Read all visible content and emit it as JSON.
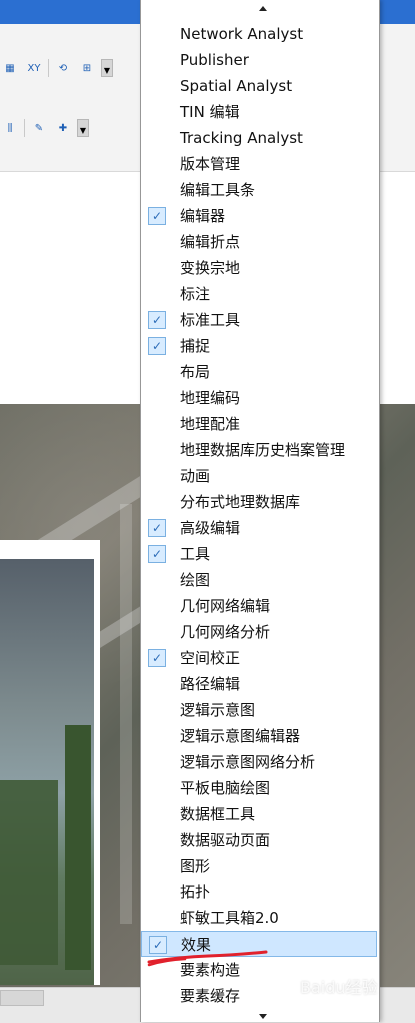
{
  "menu": {
    "items": [
      {
        "label": "Network Analyst",
        "checked": false
      },
      {
        "label": "Publisher",
        "checked": false
      },
      {
        "label": "Spatial Analyst",
        "checked": false
      },
      {
        "label": "TIN 编辑",
        "checked": false
      },
      {
        "label": "Tracking Analyst",
        "checked": false
      },
      {
        "label": "版本管理",
        "checked": false
      },
      {
        "label": "编辑工具条",
        "checked": false
      },
      {
        "label": "编辑器",
        "checked": true
      },
      {
        "label": "编辑折点",
        "checked": false
      },
      {
        "label": "变换宗地",
        "checked": false
      },
      {
        "label": "标注",
        "checked": false
      },
      {
        "label": "标准工具",
        "checked": true
      },
      {
        "label": "捕捉",
        "checked": true
      },
      {
        "label": "布局",
        "checked": false
      },
      {
        "label": "地理编码",
        "checked": false
      },
      {
        "label": "地理配准",
        "checked": false
      },
      {
        "label": "地理数据库历史档案管理",
        "checked": false
      },
      {
        "label": "动画",
        "checked": false
      },
      {
        "label": "分布式地理数据库",
        "checked": false
      },
      {
        "label": "高级编辑",
        "checked": true
      },
      {
        "label": "工具",
        "checked": true
      },
      {
        "label": "绘图",
        "checked": false
      },
      {
        "label": "几何网络编辑",
        "checked": false
      },
      {
        "label": "几何网络分析",
        "checked": false
      },
      {
        "label": "空间校正",
        "checked": true
      },
      {
        "label": "路径编辑",
        "checked": false
      },
      {
        "label": "逻辑示意图",
        "checked": false
      },
      {
        "label": "逻辑示意图编辑器",
        "checked": false
      },
      {
        "label": "逻辑示意图网络分析",
        "checked": false
      },
      {
        "label": "平板电脑绘图",
        "checked": false
      },
      {
        "label": "数据框工具",
        "checked": false
      },
      {
        "label": "数据驱动页面",
        "checked": false
      },
      {
        "label": "图形",
        "checked": false
      },
      {
        "label": "拓扑",
        "checked": false
      },
      {
        "label": "虾敏工具箱2.0",
        "checked": false
      },
      {
        "label": "效果",
        "checked": true,
        "highlighted": true
      },
      {
        "label": "要素构造",
        "checked": false
      },
      {
        "label": "要素缓存",
        "checked": false
      }
    ]
  },
  "watermark": "Baidu经验",
  "toolbar": {
    "xy_label": "XY",
    "dropdown_label": "▼"
  },
  "colors": {
    "accent": "#2b6fd1",
    "highlight": "#cfe7ff",
    "annotation_red": "#e1212c"
  }
}
